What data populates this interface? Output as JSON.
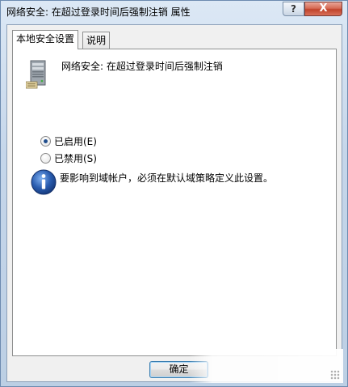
{
  "window": {
    "title": "网络安全: 在超过登录时间后强制注销 属性",
    "help_button": "?",
    "close_button": "X"
  },
  "tabs": [
    {
      "label": "本地安全设置",
      "active": true
    },
    {
      "label": "说明",
      "active": false
    }
  ],
  "policy": {
    "icon": "server-icon",
    "name": "网络安全: 在超过登录时间后强制注销"
  },
  "options": {
    "enabled": {
      "label": "已启用(E)",
      "checked": true
    },
    "disabled": {
      "label": "已禁用(S)",
      "checked": false
    }
  },
  "info": {
    "icon": "info-icon",
    "text": "要影响到域帐户，必须在默认域策略定义此设置。"
  },
  "buttons": {
    "ok": "确定"
  },
  "colors": {
    "title_bar": "#c5d6ea",
    "close_button": "#c0432b",
    "info_icon": "#2a5db0"
  }
}
